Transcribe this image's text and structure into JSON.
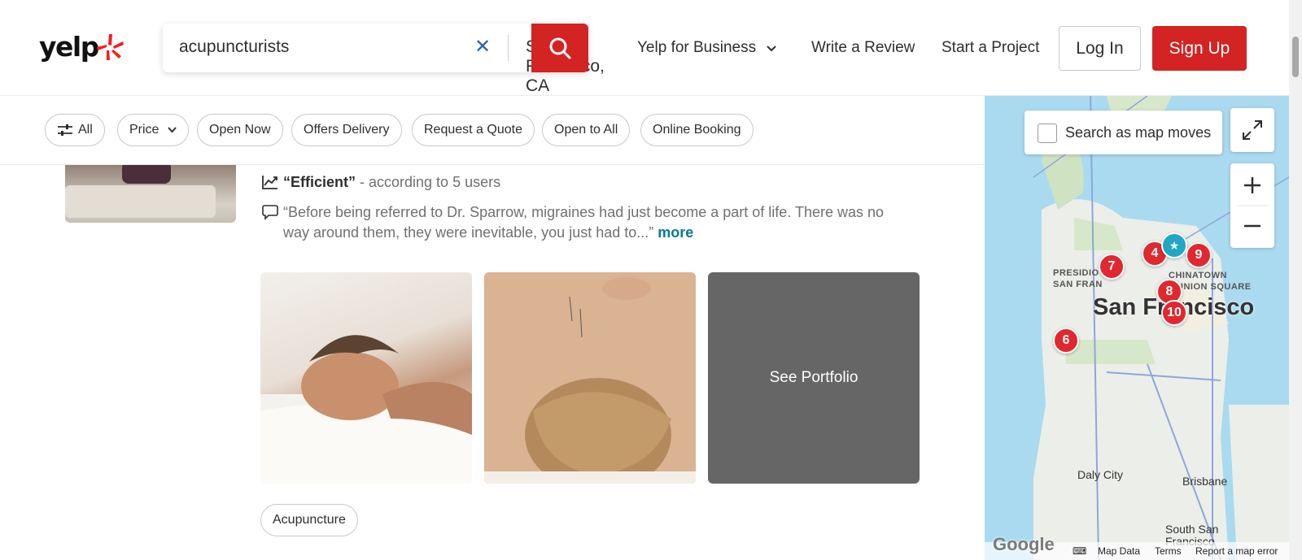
{
  "header": {
    "logo_text": "yelp",
    "search_what": "acupuncturists",
    "search_where": "San Francisco, CA",
    "nav": {
      "business": "Yelp for Business",
      "review": "Write a Review",
      "project": "Start a Project"
    },
    "login": "Log In",
    "signup": "Sign Up"
  },
  "filters": [
    "All",
    "Price",
    "Open Now",
    "Offers Delivery",
    "Request a Quote",
    "Open to All",
    "Online Booking"
  ],
  "listing": {
    "highlight_quote": "“Efficient”",
    "highlight_suffix": " - according to 5 users",
    "review_text": "“Before being referred to Dr. Sparrow, migraines had just become a part of life. There was no way around them, they were inevitable, you just had to...”",
    "review_more": "more",
    "portfolio_label": "See Portfolio",
    "tag": "Acupuncture"
  },
  "map": {
    "search_as_moves": "Search as map moves",
    "city_label": "San Francisco",
    "labels": [
      "PRESIDIO",
      "SAN FRAN",
      "CHINATOWN",
      "UNION SQUARE",
      "Daly City",
      "Brisbane",
      "South San Francisco"
    ],
    "pins": [
      "7",
      "4",
      "9",
      "8",
      "10",
      "6"
    ],
    "footer": {
      "brand": "Google",
      "map_data": "Map Data",
      "terms": "Terms",
      "report": "Report a map error"
    }
  },
  "colors": {
    "brand_red": "#d32323",
    "link_teal": "#027a97",
    "pin_red": "#e0282e"
  }
}
